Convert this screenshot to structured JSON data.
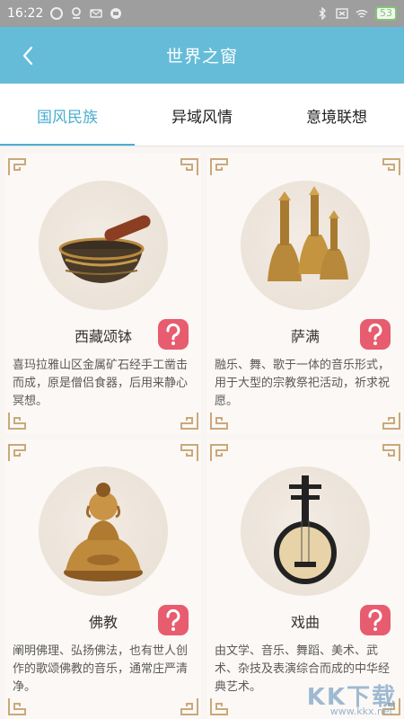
{
  "status_bar": {
    "time": "16:22",
    "battery": "53"
  },
  "header": {
    "title": "世界之窗",
    "back_icon": "chevron-left-icon"
  },
  "tabs": [
    {
      "label": "国风民族",
      "active": true
    },
    {
      "label": "异域风情",
      "active": false
    },
    {
      "label": "意境联想",
      "active": false
    }
  ],
  "colors": {
    "accent": "#4aaed2",
    "header": "#65bcd8",
    "help_badge": "#e75c6f"
  },
  "cards": [
    {
      "name": "西藏颂钵",
      "description": "喜玛拉雅山区金属矿石经手工凿击而成，原是僧侣食器，后用来静心冥想。",
      "image": "singing-bowl"
    },
    {
      "name": "萨满",
      "description": "融乐、舞、歌于一体的音乐形式，用于大型的宗教祭祀活动，祈求祝愿。",
      "image": "shaman-bells"
    },
    {
      "name": "佛教",
      "description": "阐明佛理、弘扬佛法，也有世人创作的歌颂佛教的音乐，通常庄严清净。",
      "image": "buddha-statue"
    },
    {
      "name": "戏曲",
      "description": "由文学、音乐、舞蹈、美术、武术、杂技及表演综合而成的中华经典艺术。",
      "image": "yueqin-instrument"
    }
  ],
  "watermark": {
    "text": "KK下载",
    "url": "www.kkx.net"
  }
}
